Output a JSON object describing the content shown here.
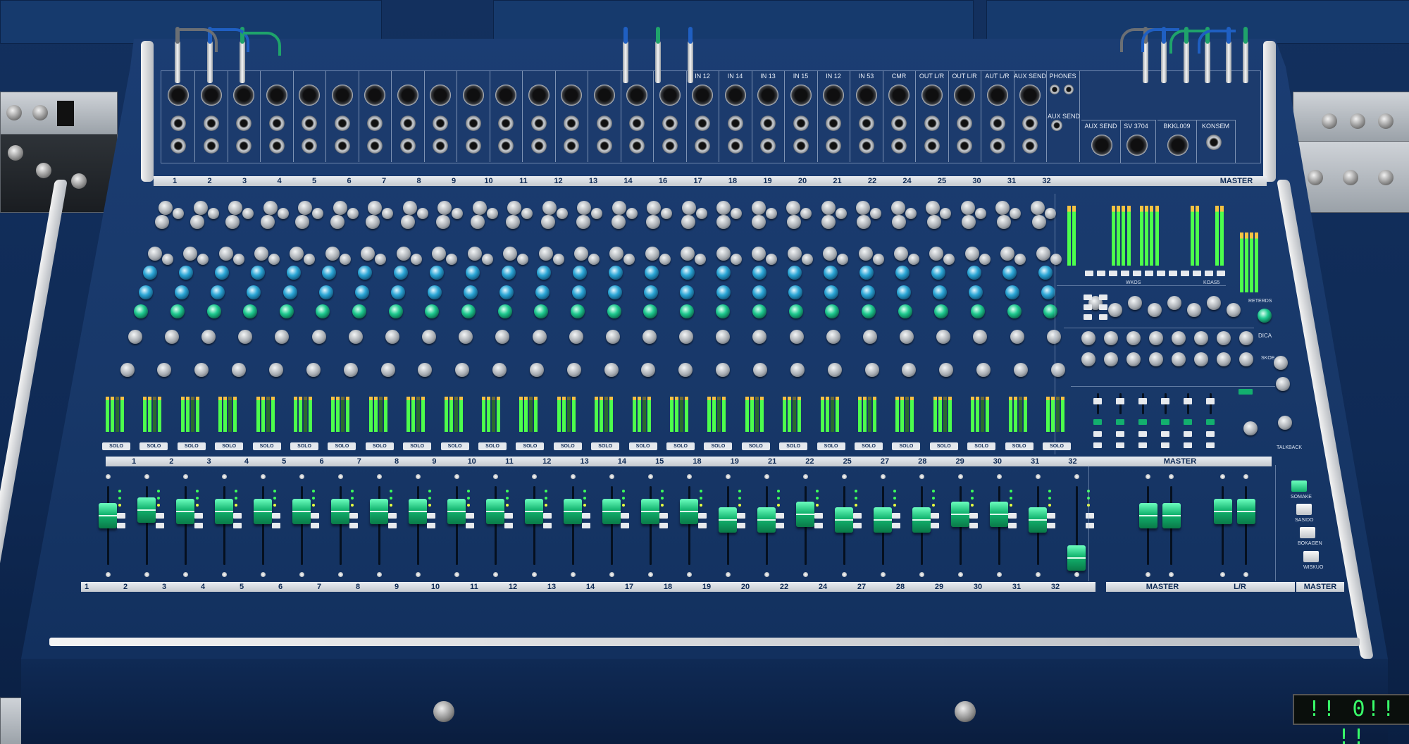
{
  "jack_labels": [
    "",
    "",
    "",
    "",
    "",
    "",
    "",
    "",
    "",
    "",
    "",
    "",
    "",
    "",
    "",
    "",
    "IN 12",
    "IN 14",
    "IN 13",
    "IN 15",
    "IN 12",
    "IN 53",
    "CMR",
    "OUT L/R",
    "OUT L/R",
    "AUT L/R",
    "AUX SEND",
    "PHONES"
  ],
  "jack_labels_row2": [
    "AUX SEND",
    "AUX SEND",
    "SV 3704",
    "BKKL009",
    "KONSEM"
  ],
  "channel_numbers_top": [
    "1",
    "2",
    "3",
    "4",
    "5",
    "6",
    "7",
    "8",
    "9",
    "10",
    "11",
    "12",
    "13",
    "14",
    "16",
    "17",
    "18",
    "19",
    "20",
    "21",
    "22",
    "24",
    "25",
    "30",
    "31",
    "32"
  ],
  "master_top_label": "MASTER",
  "channel_numbers_mid": [
    "1",
    "2",
    "3",
    "4",
    "5",
    "6",
    "7",
    "8",
    "9",
    "10",
    "11",
    "12",
    "13",
    "14",
    "15",
    "18",
    "19",
    "21",
    "22",
    "25",
    "27",
    "28",
    "29",
    "30",
    "31",
    "32"
  ],
  "master_mid_label": "MASTER",
  "channel_numbers_bottom": [
    "1",
    "2",
    "3",
    "4",
    "5",
    "6",
    "7",
    "8",
    "9",
    "10",
    "11",
    "12",
    "13",
    "14",
    "17",
    "18",
    "19",
    "20",
    "22",
    "24",
    "27",
    "28",
    "29",
    "30",
    "31",
    "32"
  ],
  "bottom_labels": {
    "master": "MASTER",
    "lr": "L/R",
    "master_right": "MASTER"
  },
  "solo_label": "SOLO",
  "master_section": {
    "meter_group_labels": [
      "WKOS",
      "KOAS5"
    ],
    "side_labels": [
      "RETERDS",
      "DICA",
      "SKOE",
      "TALKBACK"
    ],
    "button_labels": [
      "SOMAKE",
      "SASIDO",
      "BOKAGEN",
      "WISKUO"
    ]
  },
  "led_display": "!! 0!! !!",
  "colors": {
    "panel": "#1b3d73",
    "fader_cap": "#12b46f",
    "meter_green": "#4cff4c",
    "knob_teal": "#2ba6d6",
    "knob_green": "#1ec98f"
  }
}
